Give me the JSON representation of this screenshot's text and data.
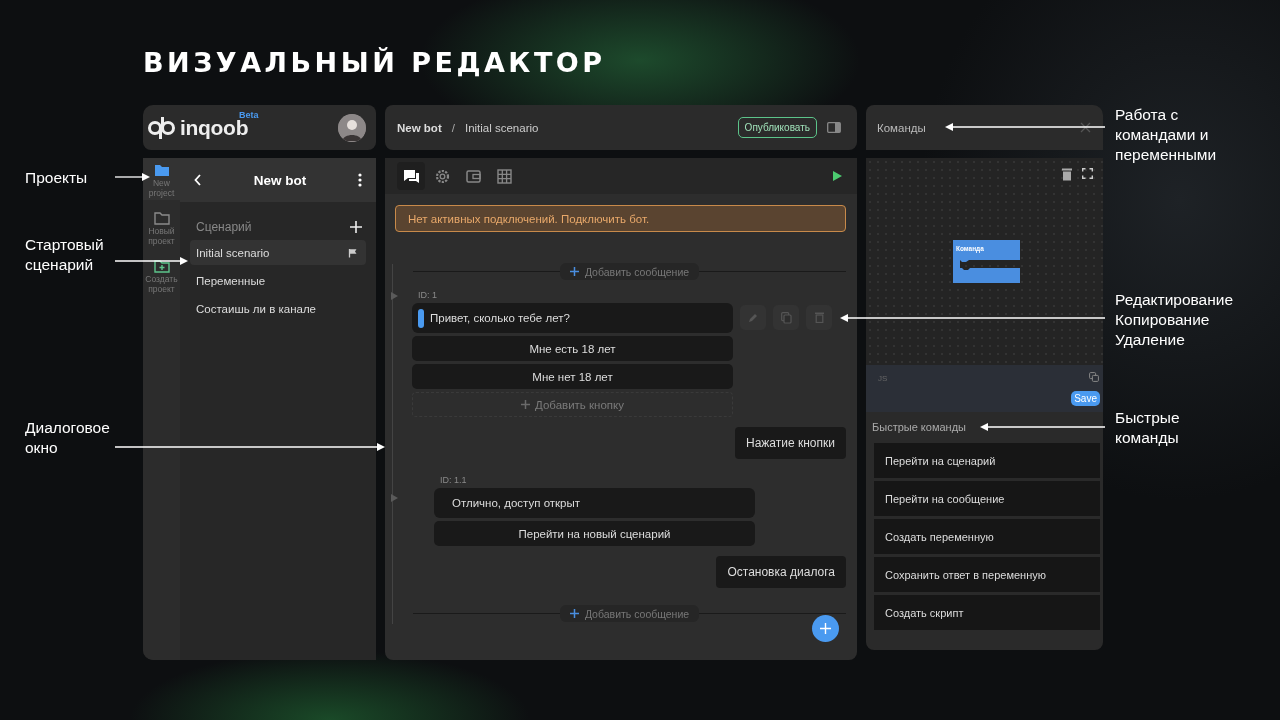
{
  "title": "ВИЗУАЛЬНЫЙ РЕДАКТОР",
  "annotations": [
    {
      "text": "Проекты"
    },
    {
      "text": "Стартовый\nсценарий"
    },
    {
      "text": "Диалоговое\nокно"
    },
    {
      "text": "Работа с\nкомандами и\nпеременными"
    },
    {
      "text": "Редактирование\nКопирование\nУдаление"
    },
    {
      "text": "Быстрые\nкоманды"
    }
  ],
  "sidebar": {
    "logo": "inqoob",
    "logo_badge": "Beta",
    "rail": [
      {
        "label": "New project",
        "kind": "folder",
        "selected": true
      },
      {
        "label": "Новый проект",
        "kind": "folder",
        "selected": false
      },
      {
        "label": "Создать проект",
        "kind": "add-folder",
        "selected": false
      }
    ],
    "project_title": "New bot",
    "section": "Сценарий",
    "items": [
      {
        "label": "Initial scenario",
        "selected": true,
        "start": true
      },
      {
        "label": "Переменные",
        "selected": false,
        "start": false
      },
      {
        "label": "Состаишь ли в канале",
        "selected": false,
        "start": false
      }
    ]
  },
  "editor": {
    "breadcrumb": {
      "bot": "New bot",
      "separator": "/",
      "scenario": "Initial scenario"
    },
    "publish_button": "Опубликовать",
    "toolbar": [
      {
        "kind": "chat",
        "selected": true
      },
      {
        "kind": "gear",
        "selected": false
      },
      {
        "kind": "wallet",
        "selected": false
      },
      {
        "kind": "grid",
        "selected": false
      }
    ],
    "warning": "Нет активных подключений. Подключить бот.",
    "flow": [
      {
        "kind": "add",
        "label": "Добавить сообщение"
      },
      {
        "kind": "message",
        "id": "ID: 1",
        "text": "Привет, сколько тебе лет?",
        "active": true,
        "buttons": [
          "Мне есть 18 лет",
          "Мне нет 18 лет"
        ],
        "add_button": "Добавить кнопку"
      },
      {
        "kind": "event",
        "label": "Нажатие кнопки"
      },
      {
        "kind": "submessage",
        "id": "ID: 1.1",
        "text": "Отлично, доступ открыт",
        "active": false,
        "buttons": [
          "Перейти на новый сценарий"
        ]
      },
      {
        "kind": "event",
        "label": "Остановка диалога"
      },
      {
        "kind": "add",
        "label": "Добавить сообщение"
      }
    ]
  },
  "commands": {
    "title": "Команды",
    "block_label": "Команда",
    "code_label": "JS",
    "save_button": "Save",
    "quick_title": "Быстрые команды",
    "quick": [
      "Перейти на сценарий",
      "Перейти на сообщение",
      "Создать переменную",
      "Сохранить ответ в переменную",
      "Создать скрипт"
    ]
  }
}
